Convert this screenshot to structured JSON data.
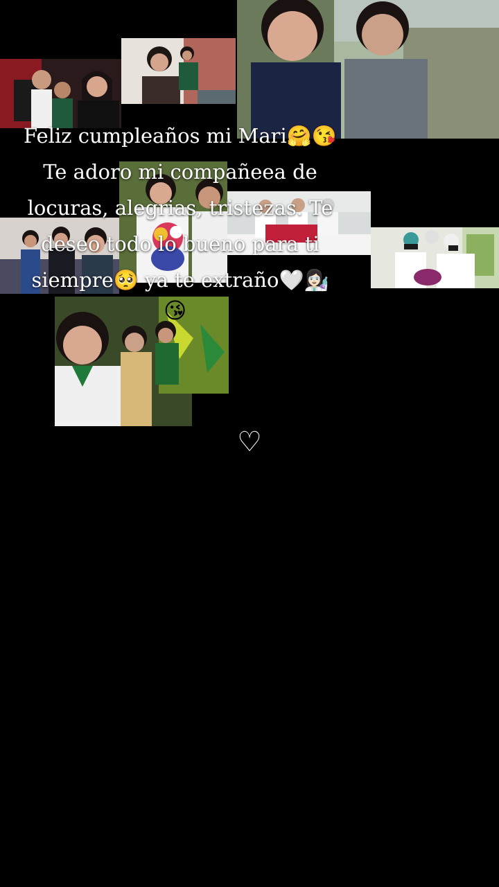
{
  "story": {
    "message": "Feliz cumpleaños mi Mari🤗😘\nTe adoro mi compañeea de locuras, alegrias, tristezas. Te deseo todo lo bueno para ti siempre🥺 ya te extraño🤍👩🏻‍🔬",
    "floating_emoji": "😘",
    "heart_symbol": "♡"
  },
  "colors": {
    "background": "#000000",
    "text": "#ffffff"
  }
}
